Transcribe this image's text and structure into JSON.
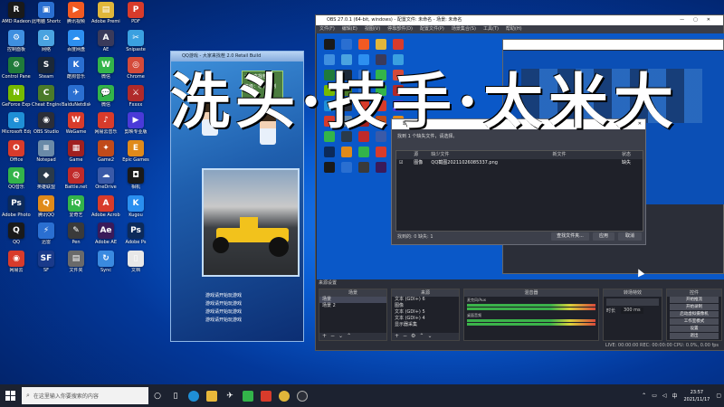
{
  "desktop": {
    "icons": [
      {
        "label": "AMD Radeon Software",
        "glyph": "R",
        "color": "#1a1a1a"
      },
      {
        "label": "此电脑 Shortcut",
        "glyph": "▣",
        "color": "#2a6fd1"
      },
      {
        "label": "腾讯视频",
        "glyph": "▶",
        "color": "#f25a22"
      },
      {
        "label": "Adobe Premiere",
        "glyph": "▤",
        "color": "#e0b63a"
      },
      {
        "label": "PDF",
        "glyph": "P",
        "color": "#d83b2b"
      },
      {
        "label": "控制面板",
        "glyph": "⚙",
        "color": "#3f8fe0"
      },
      {
        "label": "网络",
        "glyph": "⌂",
        "color": "#4aa3e0"
      },
      {
        "label": "百度网盘",
        "glyph": "☁",
        "color": "#2d8ff0"
      },
      {
        "label": "AE",
        "glyph": "A",
        "color": "#3a3a5a"
      },
      {
        "label": "Snipaste",
        "glyph": "✂",
        "color": "#3aa0e0"
      },
      {
        "label": "Control Panel",
        "glyph": "⚙",
        "color": "#1f7a3a"
      },
      {
        "label": "Steam",
        "glyph": "S",
        "color": "#1b2838"
      },
      {
        "label": "酷狗音乐",
        "glyph": "K",
        "color": "#2a6fd1"
      },
      {
        "label": "微信",
        "glyph": "W",
        "color": "#33b44a"
      },
      {
        "label": "Chrome",
        "glyph": "◎",
        "color": "#d44a3a"
      },
      {
        "label": "GeForce Experience",
        "glyph": "N",
        "color": "#76b900"
      },
      {
        "label": "Cheat Engine",
        "glyph": "C",
        "color": "#4a7a2a"
      },
      {
        "label": "BaiduNetdisk",
        "glyph": "✈",
        "color": "#2a6fd1"
      },
      {
        "label": "微信",
        "glyph": "💬",
        "color": "#33b44a"
      },
      {
        "label": "Fxxxx",
        "glyph": "⚔",
        "color": "#b02a2a"
      },
      {
        "label": "Microsoft Edge",
        "glyph": "e",
        "color": "#1f8fd6"
      },
      {
        "label": "OBS Studio",
        "glyph": "◉",
        "color": "#2b2e38"
      },
      {
        "label": "WeGame",
        "glyph": "W",
        "color": "#d83b2b"
      },
      {
        "label": "网易云音乐",
        "glyph": "♪",
        "color": "#d83b2b"
      },
      {
        "label": "剪映专业版",
        "glyph": "▶",
        "color": "#4a3ad8"
      },
      {
        "label": "Office",
        "glyph": "O",
        "color": "#d83b2b"
      },
      {
        "label": "Notepad",
        "glyph": "≡",
        "color": "#6a8aa8"
      },
      {
        "label": "Game",
        "glyph": "▦",
        "color": "#a02020"
      },
      {
        "label": "Game2",
        "glyph": "✦",
        "color": "#c04a1a"
      },
      {
        "label": "Epic Games",
        "glyph": "E",
        "color": "#e08a1a"
      },
      {
        "label": "QQ音乐",
        "glyph": "Q",
        "color": "#33b44a"
      },
      {
        "label": "英雄联盟",
        "glyph": "◆",
        "color": "#2a3a4a"
      },
      {
        "label": "Battle.net",
        "glyph": "◎",
        "color": "#c02a2a"
      },
      {
        "label": "OneDrive",
        "glyph": "☁",
        "color": "#3a5aa8"
      },
      {
        "label": "相机",
        "glyph": "◘",
        "color": "#1a1a1a"
      },
      {
        "label": "Adobe Photoshop",
        "glyph": "Ps",
        "color": "#0c2a5a"
      },
      {
        "label": "腾讯QQ",
        "glyph": "Q",
        "color": "#e08a1a"
      },
      {
        "label": "爱奇艺",
        "glyph": "iQ",
        "color": "#33b44a"
      },
      {
        "label": "Adobe Acrobat",
        "glyph": "A",
        "color": "#d83b2b"
      },
      {
        "label": "Kugou",
        "glyph": "K",
        "color": "#2a8ff0"
      },
      {
        "label": "QQ",
        "glyph": "Q",
        "color": "#1a1a1a"
      },
      {
        "label": "迅雷",
        "glyph": "⚡",
        "color": "#2a6fd1"
      },
      {
        "label": "Pen",
        "glyph": "✎",
        "color": "#3a3a3a"
      },
      {
        "label": "Adobe AE",
        "glyph": "Ae",
        "color": "#3a1a5a"
      },
      {
        "label": "Adobe Ps",
        "glyph": "Ps",
        "color": "#0c2a5a"
      },
      {
        "label": "网易云",
        "glyph": "◉",
        "color": "#d83b2b"
      },
      {
        "label": "SF",
        "glyph": "SF",
        "color": "#1a3a8a"
      },
      {
        "label": "文件夹",
        "glyph": "▤",
        "color": "#6a6a6a"
      },
      {
        "label": "Sync",
        "glyph": "↻",
        "color": "#3a8ae0"
      },
      {
        "label": "文档",
        "glyph": "▯",
        "color": "#e8e8e8"
      }
    ]
  },
  "game_window": {
    "title": "QQ游戏 - 大家来找茬 2.0 Retail Build",
    "banner_lines": [
      "大家来找茬",
      "等级：心相系列"
    ],
    "list_lines": [
      "游戏请开始玩游戏",
      "游戏请开始玩游戏",
      "游戏请开始玩游戏",
      "游戏请开始玩游戏"
    ]
  },
  "obs": {
    "title": "OBS 27.0.1 (64-bit, windows) - 配置文件: 未命名 - 场景: 未命名",
    "menu": [
      "文件(F)",
      "编辑(E)",
      "视图(V)",
      "停靠部件(D)",
      "配置文件(P)",
      "场景集合(S)",
      "工具(T)",
      "帮助(H)"
    ],
    "dock_header": "来源设置",
    "scenes_title": "场景",
    "scenes": [
      "场景",
      "场景 2"
    ],
    "sources_title": "来源",
    "sources": [
      "文本 (GDI+) 6",
      "图像",
      "文本 (GDI+) 5",
      "文本 (GDI+) 4",
      "显示器采集"
    ],
    "mixer_title": "混音器",
    "mixer_tracks": [
      "麦克风/Aux",
      "桌面音频"
    ],
    "transition_title": "转场特效",
    "transition_duration_label": "时长",
    "transition_duration": "300 ms",
    "controls_title": "控件",
    "controls": [
      "开始推流",
      "开始录制",
      "启动虚拟摄像机",
      "工作室模式",
      "设置",
      "退出"
    ],
    "status": "LIVE: 00:00:00   REC: 00:00:00   CPU: 0.0%, 0.00 fps"
  },
  "dialog": {
    "title": "缺失文件",
    "message": "找到 1 个缺失文件，请选择。",
    "headers": [
      "",
      "源",
      "缺少文件",
      "新文件",
      "状态"
    ],
    "rows": [
      {
        "source": "图像",
        "file": "QQ截图20211026085337.png",
        "new": "",
        "status": "缺失"
      }
    ],
    "found": "找到的: 0  缺失: 1",
    "buttons": [
      "查找文件夹...",
      "应用",
      "取消"
    ]
  },
  "watermark": "洗头·技手·太米大",
  "taskbar": {
    "search_placeholder": "在这里输入你要搜索的内容",
    "time": "23:57",
    "date": "2021/11/17",
    "lang": "中"
  },
  "colors": {
    "obs_bg": "#2b2e38",
    "taskbar_bg": "#1c2230",
    "desktop_blue": "#0a5fd6"
  }
}
